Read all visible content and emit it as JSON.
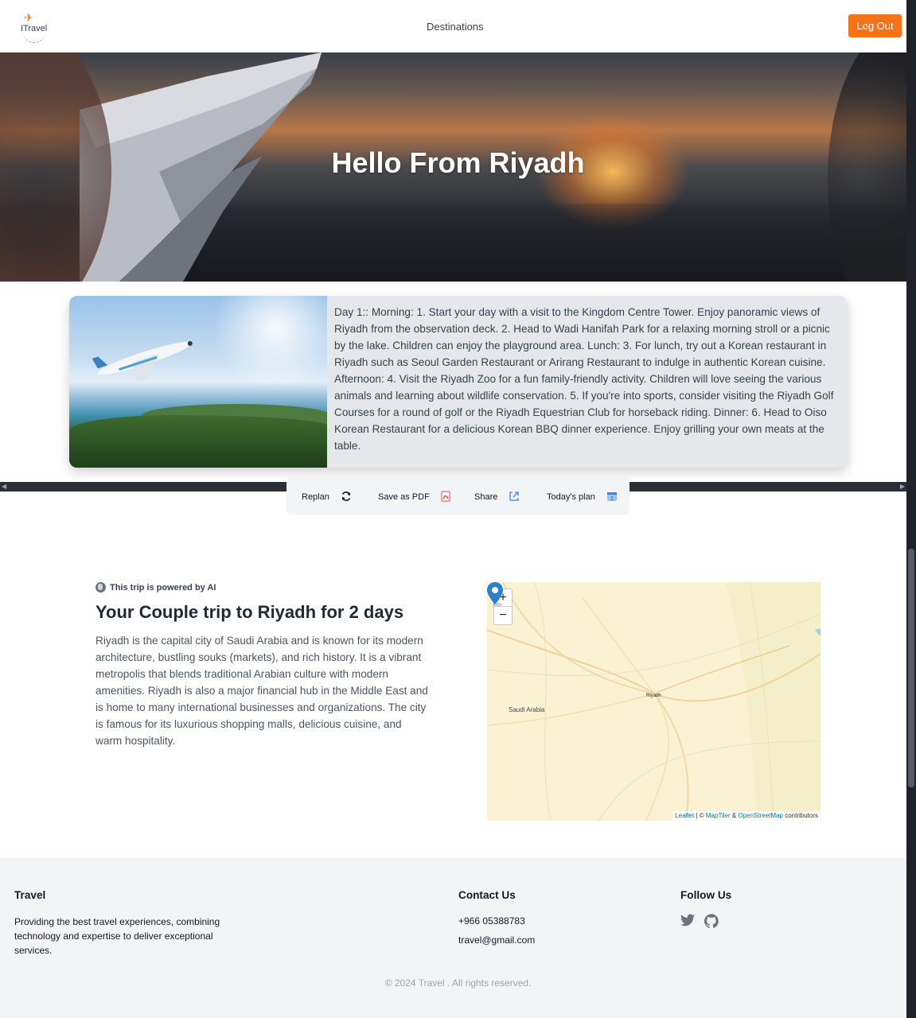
{
  "header": {
    "logo_text": "ITravel",
    "nav_destinations": "Destinations",
    "logout_label": "Log Out"
  },
  "hero": {
    "title": "Hello From Riyadh"
  },
  "itinerary": {
    "text": "Day 1:: Morning: 1. Start your day with a visit to the Kingdom Centre Tower. Enjoy panoramic views of Riyadh from the observation deck. 2. Head to Wadi Hanifah Park for a relaxing morning stroll or a picnic by the lake. Children can enjoy the playground area. Lunch: 3. For lunch, try out a Korean restaurant in Riyadh such as Seoul Garden Restaurant or Arirang Restaurant to indulge in authentic Korean cuisine. Afternoon: 4. Visit the Riyadh Zoo for a fun family-friendly activity. Children will love seeing the various animals and learning about wildlife conservation. 5. If you're into sports, consider visiting the Riyadh Golf Courses for a round of golf or the Riyadh Equestrian Club for horseback riding. Dinner: 6. Head to Oiso Korean Restaurant for a delicious Korean BBQ dinner experience. Enjoy grilling your own meats at the table."
  },
  "actions": {
    "replan": "Replan",
    "save_pdf": "Save as PDF",
    "share": "Share",
    "today": "Today's plan"
  },
  "trip": {
    "powered": "This trip is powered by AI",
    "title": "Your Couple trip to Riyadh for 2 days",
    "description": "Riyadh is the capital city of Saudi Arabia and is known for its modern architecture, bustling souks (markets), and rich history. It is a vibrant metropolis that blends traditional Arabian culture with modern amenities. Riyadh is also a major financial hub in the Middle East and is home to many international businesses and organizations. The city is famous for its luxurious shopping malls, delicious cuisine, and warm hospitality."
  },
  "map": {
    "zoom_in": "+",
    "zoom_out": "−",
    "country_label": "Saudi Arabia",
    "city_label": "Riyadh",
    "attribution": {
      "leaflet": "Leaflet",
      "sep": " | © ",
      "maptiler": "MapTiler",
      "amp": " & ",
      "osm": "OpenStreetMap",
      "contributors": " contributors"
    }
  },
  "footer": {
    "travel_heading": "Travel",
    "travel_desc": "Providing the best travel experiences, combining technology and expertise to deliver exceptional services.",
    "contact_heading": "Contact Us",
    "phone": "+966 05388783",
    "email": "travel@gmail.com",
    "follow_heading": "Follow Us",
    "copyright": "© 2024 Travel . All rights reserved."
  },
  "colors": {
    "accent": "#f97316",
    "footer_bg": "#f3f4f6",
    "card_bg": "#e5e7eb"
  },
  "icons": [
    "airplane-logo-icon",
    "refresh-icon",
    "pdf-icon",
    "share-icon",
    "calendar-icon",
    "globe-icon",
    "map-pin-icon",
    "twitter-icon",
    "github-icon"
  ]
}
